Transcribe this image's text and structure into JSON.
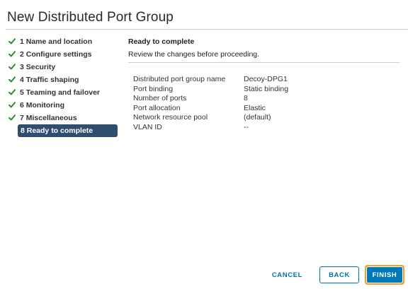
{
  "dialog": {
    "title": "New Distributed Port Group"
  },
  "steps": [
    {
      "label": "1 Name and location",
      "done": true
    },
    {
      "label": "2 Configure settings",
      "done": true
    },
    {
      "label": "3 Security",
      "done": true
    },
    {
      "label": "4 Traffic shaping",
      "done": true
    },
    {
      "label": "5 Teaming and failover",
      "done": true
    },
    {
      "label": "6 Monitoring",
      "done": true
    },
    {
      "label": "7 Miscellaneous",
      "done": true
    },
    {
      "label": "8 Ready to complete",
      "done": false,
      "active": true
    }
  ],
  "content": {
    "title": "Ready to complete",
    "subtitle": "Review the changes before proceeding."
  },
  "summary": [
    {
      "label": "Distributed port group name",
      "value": "Decoy-DPG1"
    },
    {
      "label": "Port binding",
      "value": "Static binding"
    },
    {
      "label": "Number of ports",
      "value": "8"
    },
    {
      "label": "Port allocation",
      "value": "Elastic"
    },
    {
      "label": "Network resource pool",
      "value": "(default)"
    },
    {
      "label": "VLAN ID",
      "value": "--"
    }
  ],
  "footer": {
    "cancel_label": "CANCEL",
    "back_label": "BACK",
    "finish_label": "FINISH"
  },
  "colors": {
    "check": "#2e8b2e",
    "active_step_bg": "#2f4d6f",
    "primary": "#0079b8",
    "link": "#0072a3",
    "focus_ring": "#f39c2a"
  },
  "icons": {
    "step_done": "check-icon"
  }
}
